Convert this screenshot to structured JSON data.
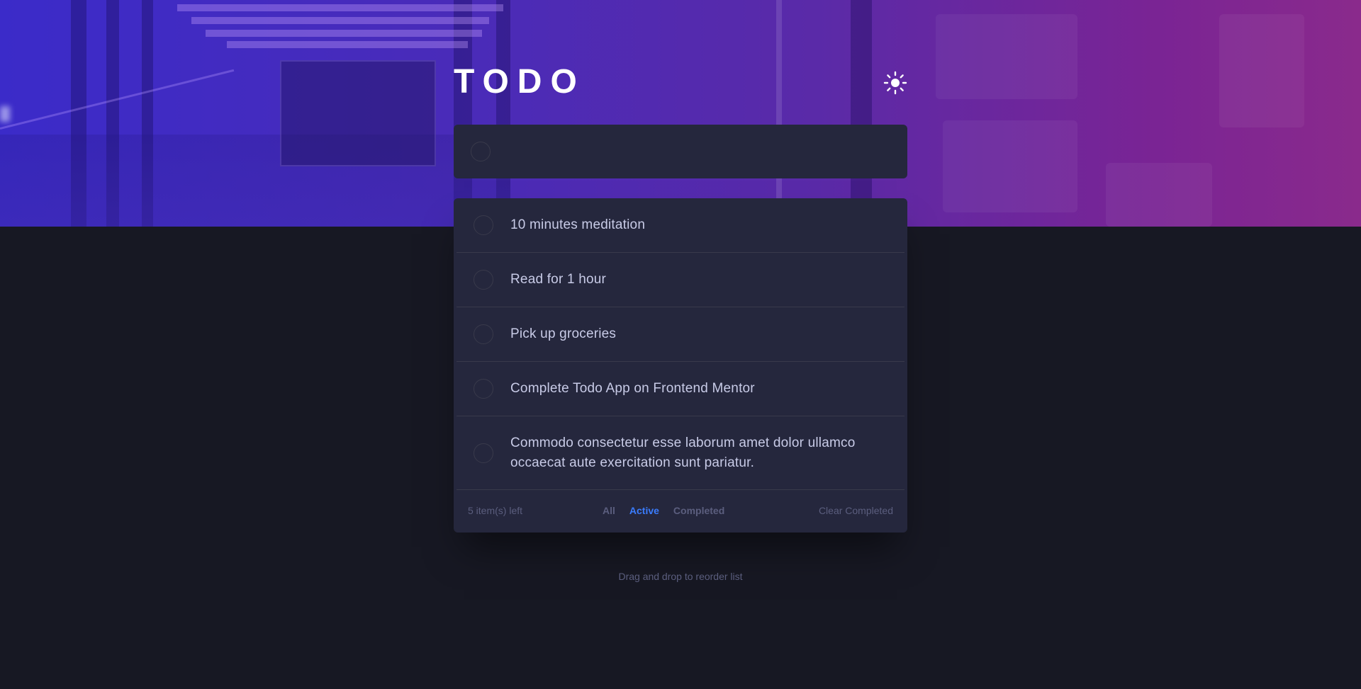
{
  "app": {
    "title": "TODO"
  },
  "theme_toggle": {
    "icon": "sun-icon"
  },
  "new_todo": {
    "placeholder": "",
    "value": ""
  },
  "todos": [
    {
      "text": "10 minutes meditation",
      "completed": false
    },
    {
      "text": "Read for 1 hour",
      "completed": false
    },
    {
      "text": "Pick up groceries",
      "completed": false
    },
    {
      "text": "Complete Todo App on Frontend Mentor",
      "completed": false
    },
    {
      "text": "Commodo consectetur esse laborum amet dolor ullamco occaecat aute exercitation sunt pariatur.",
      "completed": false
    }
  ],
  "footer": {
    "items_left": "5 item(s) left",
    "filters": [
      "All",
      "Active",
      "Completed"
    ],
    "active_filter": "Active",
    "clear_label": "Clear Completed"
  },
  "hint": "Drag and drop to reorder list",
  "colors": {
    "background": "#171823",
    "card": "#25273d",
    "text": "#c8cbe7",
    "muted": "#5b5e7e",
    "accent": "#3a7cfd",
    "divider": "#393a4b"
  }
}
